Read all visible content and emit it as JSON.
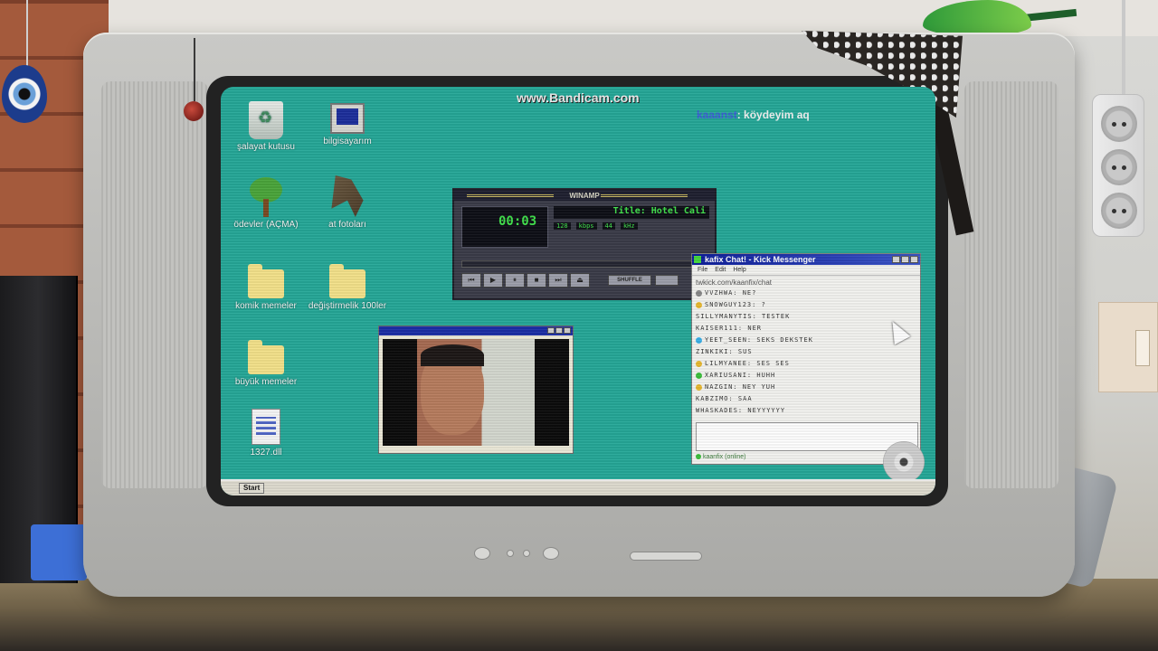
{
  "watermark": "www.Bandicam.com",
  "chat_overlay": {
    "user": "kaaanst",
    "message": "köydeyim aq"
  },
  "desktop": {
    "icons": [
      {
        "label": "şalayat kutusu",
        "icon": "recycle-bin-icon"
      },
      {
        "label": "bilgisayarım",
        "icon": "computer-icon"
      },
      {
        "label": "ödevler (AÇMA)",
        "icon": "tree-icon"
      },
      {
        "label": "at fotoları",
        "icon": "horse-icon"
      },
      {
        "label": "komik memeler",
        "icon": "folder-icon"
      },
      {
        "label": "değiştirmelik 100ler",
        "icon": "folder-icon"
      },
      {
        "label": "büyük memeler",
        "icon": "folder-icon"
      },
      {
        "label": "1327.dll",
        "icon": "file-icon"
      }
    ]
  },
  "winamp": {
    "title": "WINAMP",
    "time": "00:03",
    "song": "Title: Hotel Cali",
    "kbps": "128",
    "kbps_unit": "kbps",
    "khz": "44",
    "khz_unit": "kHz",
    "shuffle_label": "SHUFFLE",
    "playlist_label": "#"
  },
  "messenger": {
    "title": "kafix Chat! - Kick Messenger",
    "menu": [
      "File",
      "Edit",
      "Help"
    ],
    "url": "twkick.com/kaanfix/chat",
    "messages": [
      {
        "text": "VVZHWA: NE?",
        "color": "#888888"
      },
      {
        "text": "SNOWGUY123: ?",
        "color": "#e8b830"
      },
      {
        "text": "SILLYMANYTIS: TESTEK",
        "color": ""
      },
      {
        "text": "KAISER111: NER",
        "color": ""
      },
      {
        "text": "YEET_SEEN: SEKS DEKSTEK",
        "color": "#3bb0e8"
      },
      {
        "text": "ZINKIKI: SUS",
        "color": ""
      },
      {
        "text": "LILMYANEE: SES SES",
        "color": "#e8b830"
      },
      {
        "text": "XARIUSANI: HUHH",
        "color": "#3bbf3b"
      },
      {
        "text": "NAZGIN: NEY YUH",
        "color": "#e8b830"
      },
      {
        "text": "KABZIMO: SAA",
        "color": ""
      },
      {
        "text": "WHASKADES: NEYYYYYY",
        "color": ""
      }
    ],
    "status": "kaanfix (online)"
  },
  "taskbar": {
    "start_label": "Start"
  }
}
